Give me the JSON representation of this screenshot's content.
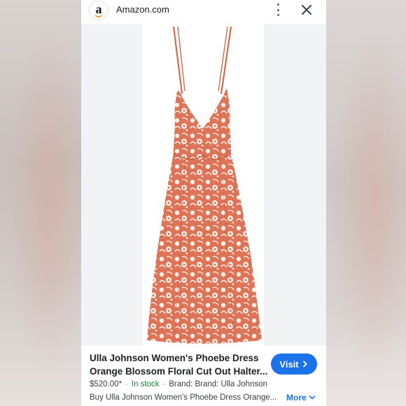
{
  "header": {
    "site_name": "Amazon.com",
    "logo_letter": "a"
  },
  "product": {
    "title_line1": "Ulla Johnson Women's Phoebe Dress",
    "title_line2": "Orange Blossom Floral Cut Out Halter...",
    "price": "$520.00*",
    "stock": "In stock",
    "brand": "Brand: Brand: Ulla Johnson",
    "description": "Buy Ulla Johnson Women's Phoebe Dress Orange...",
    "image_subject": "floral-maxi-dress"
  },
  "actions": {
    "visit_label": "Visit",
    "more_label": "More"
  },
  "colors": {
    "accent": "#1a73e8",
    "stock_green": "#188038",
    "dress_base": "#e07a5f",
    "dress_print": "#f7ede6"
  }
}
